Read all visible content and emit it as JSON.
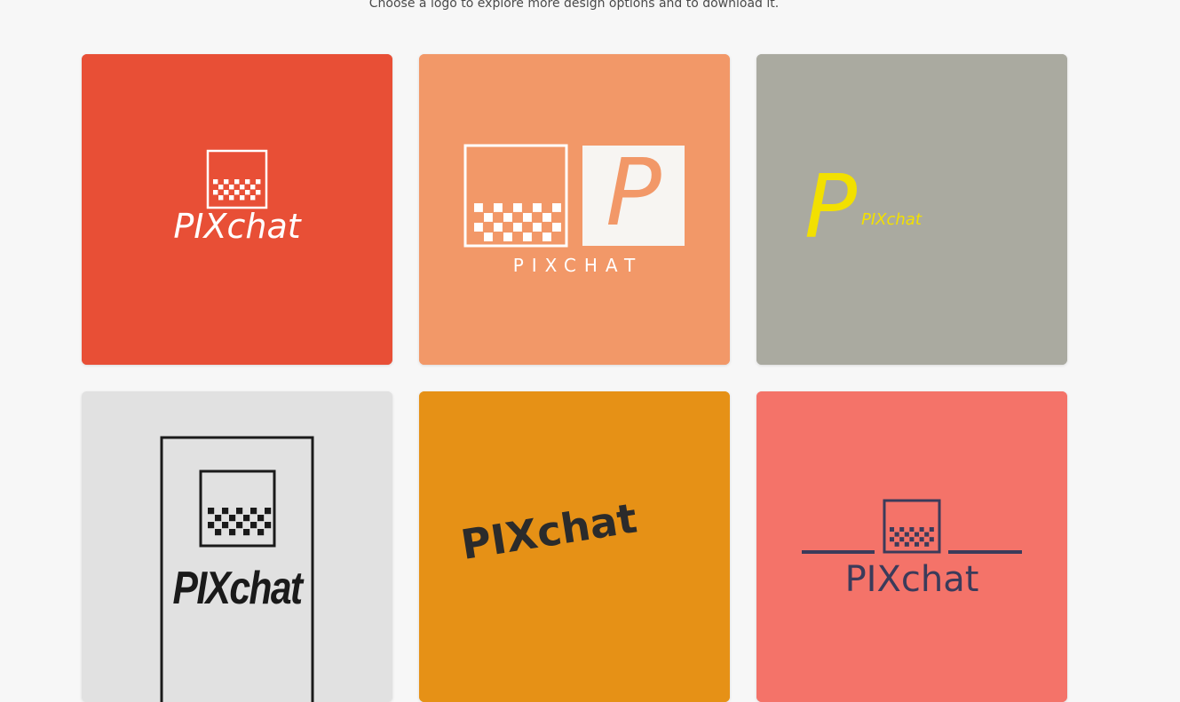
{
  "page": {
    "subtitle": "Choose a logo to explore more design options and to download it."
  },
  "logos": [
    {
      "text": "PIXchat",
      "bg": "#e84f36",
      "fg": "#ffffff"
    },
    {
      "text": "PIXCHAT",
      "monogram": "P",
      "bg": "#f29868",
      "fg": "#ffffff",
      "accent": "#f29868"
    },
    {
      "text": "PIXchat",
      "monogram": "P",
      "bg": "#aaaaa0",
      "fg": "#f2e000"
    },
    {
      "text": "PIXchat",
      "bg": "#e1e1e1",
      "fg": "#1a1a1a"
    },
    {
      "text": "PIXchat",
      "bg": "#e69116",
      "fg": "#2b2b2b"
    },
    {
      "text": "PIXchat",
      "bg": "#f47369",
      "fg": "#3b3b5a"
    }
  ]
}
